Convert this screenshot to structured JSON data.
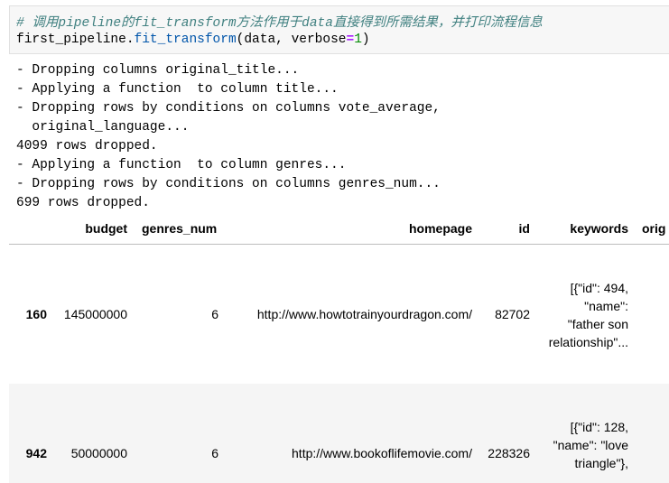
{
  "code_cell": {
    "comment": "# 调用pipeline的fit_transform方法作用于data直接得到所需结果，并打印流程信息",
    "code": {
      "obj": "first_pipeline.",
      "method": "fit_transform",
      "args_pre": "(data, verbose",
      "eq": "=",
      "val": "1",
      "close": ")"
    }
  },
  "output_lines": [
    "- Dropping columns original_title...",
    "- Applying a function  to column title...",
    "- Dropping rows by conditions on columns vote_average,",
    "  original_language...",
    "4099 rows dropped.",
    "- Applying a function  to column genres...",
    "- Dropping rows by conditions on columns genres_num...",
    "699 rows dropped."
  ],
  "table": {
    "columns": [
      "budget",
      "genres_num",
      "homepage",
      "id",
      "keywords",
      "orig"
    ],
    "rows": [
      {
        "index": "160",
        "budget": "145000000",
        "genres_num": "6",
        "homepage": "http://www.howtotrainyourdragon.com/",
        "id": "82702",
        "keywords": [
          "[{\"id\": 494,",
          "\"name\":",
          "\"father son",
          "relationship\"..."
        ]
      },
      {
        "index": "942",
        "budget": "50000000",
        "genres_num": "6",
        "homepage": "http://www.bookoflifemovie.com/",
        "id": "228326",
        "keywords": [
          "[{\"id\": 128,",
          "\"name\": \"love",
          "triangle\"},"
        ]
      }
    ]
  }
}
